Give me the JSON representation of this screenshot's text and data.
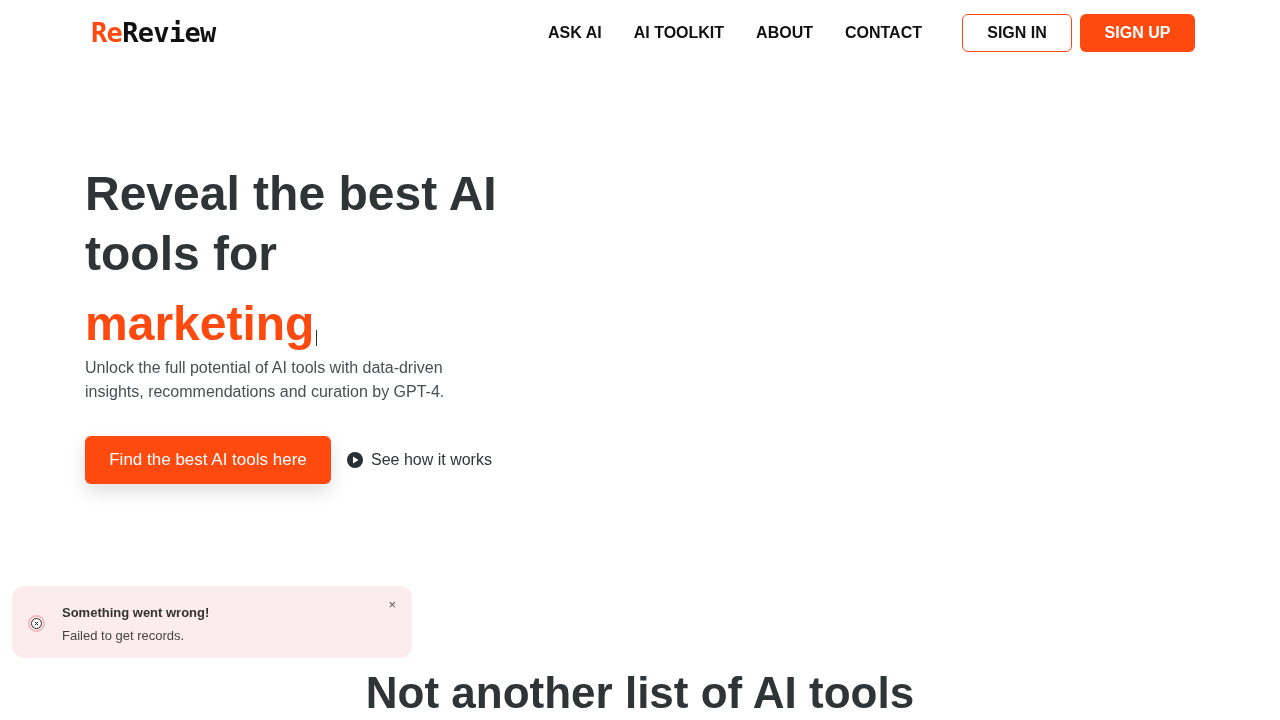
{
  "logo": {
    "accent": "Re",
    "rest": "Review"
  },
  "nav": {
    "links": [
      "ASK AI",
      "AI TOOLKIT",
      "ABOUT",
      "CONTACT"
    ],
    "sign_in": "SIGN IN",
    "sign_up": "SIGN UP"
  },
  "hero": {
    "title": "Reveal the best AI tools for",
    "highlight": "marketing",
    "subtitle": "Unlock the full potential of AI tools with data-driven insights, recommendations and curation by GPT-4.",
    "primary_button": "Find the best AI tools here",
    "secondary_link": "See how it works"
  },
  "toast": {
    "title": "Something went wrong!",
    "message": "Failed to get records.",
    "close": "×"
  },
  "section_heading": "Not another list of AI tools"
}
